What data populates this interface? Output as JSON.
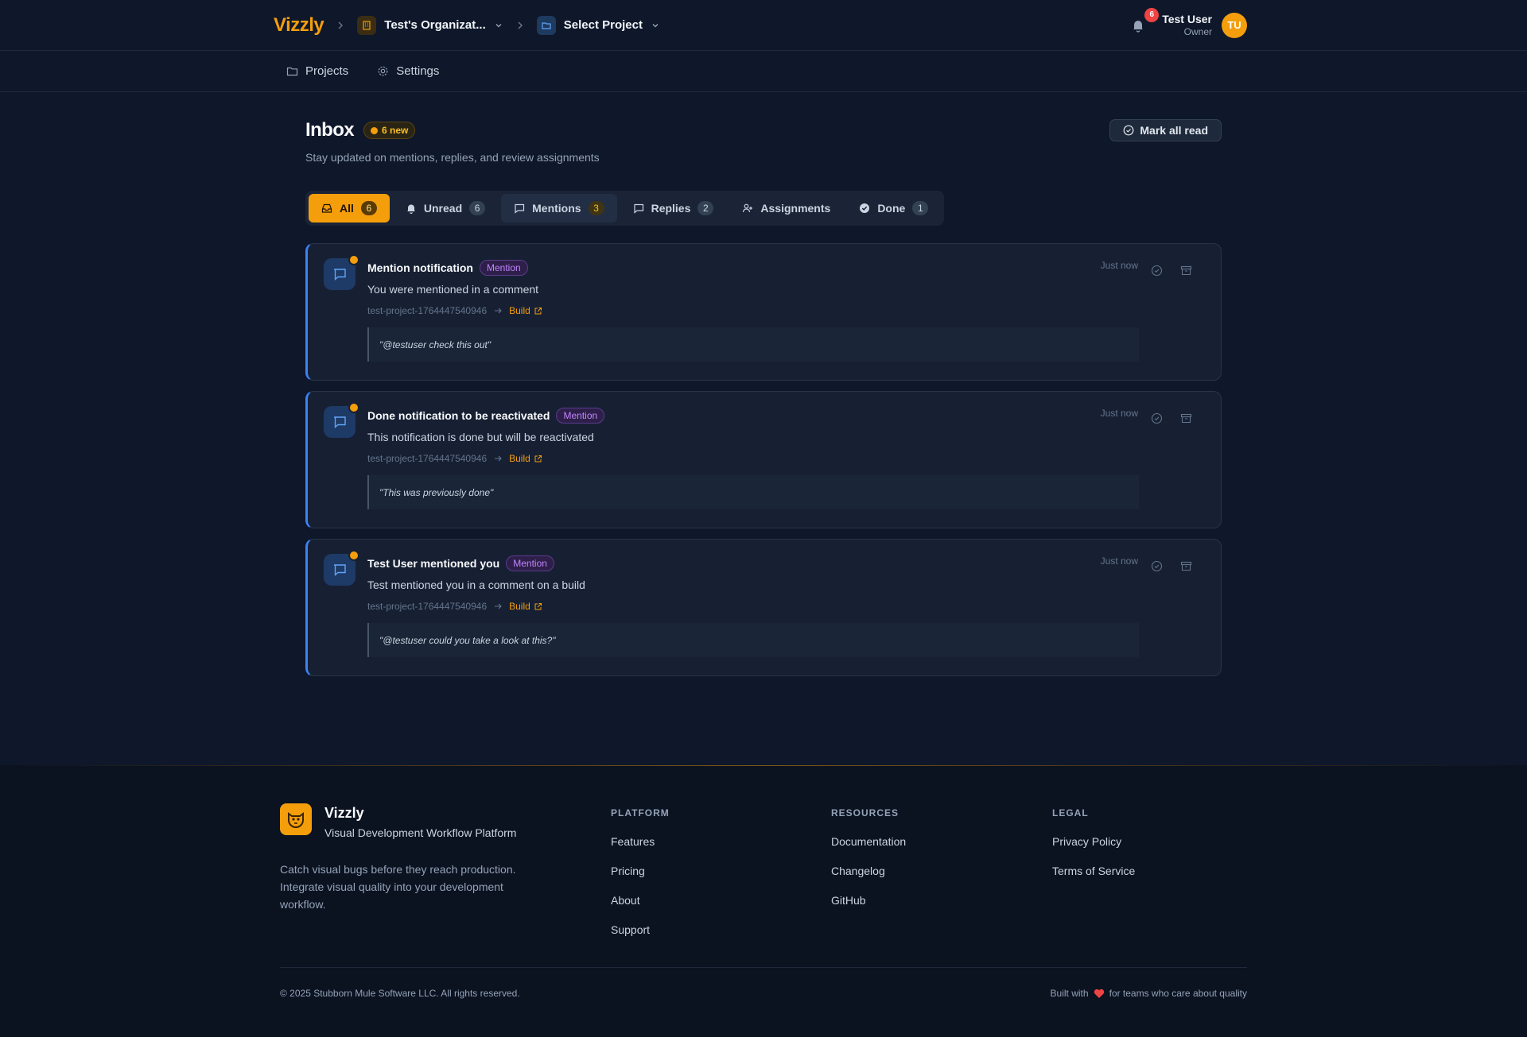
{
  "header": {
    "logo": "Vizzly",
    "org_name": "Test's Organizat...",
    "project_name": "Select Project",
    "notification_count": "6",
    "user_name": "Test User",
    "user_role": "Owner",
    "avatar_initials": "TU"
  },
  "subnav": {
    "items": [
      {
        "label": "Projects",
        "icon": "folder-icon"
      },
      {
        "label": "Settings",
        "icon": "gear-icon"
      }
    ]
  },
  "inbox": {
    "title": "Inbox",
    "new_badge": "6 new",
    "subtitle": "Stay updated on mentions, replies, and review assignments",
    "mark_all_read": "Mark all read",
    "tabs": [
      {
        "label": "All",
        "count": "6",
        "icon": "inbox-icon",
        "active": true
      },
      {
        "label": "Unread",
        "count": "6",
        "icon": "bell-icon"
      },
      {
        "label": "Mentions",
        "count": "3",
        "icon": "comment-icon"
      },
      {
        "label": "Replies",
        "count": "2",
        "icon": "reply-icon"
      },
      {
        "label": "Assignments",
        "count": "",
        "icon": "user-plus-icon"
      },
      {
        "label": "Done",
        "count": "1",
        "icon": "check-circle-icon"
      }
    ],
    "notifications": [
      {
        "title": "Mention notification",
        "type": "Mention",
        "text": "You were mentioned in a comment",
        "project": "test-project-1764447540946",
        "link": "Build",
        "quote": "\"@testuser check this out\"",
        "time": "Just now"
      },
      {
        "title": "Done notification to be reactivated",
        "type": "Mention",
        "text": "This notification is done but will be reactivated",
        "project": "test-project-1764447540946",
        "link": "Build",
        "quote": "\"This was previously done\"",
        "time": "Just now"
      },
      {
        "title": "Test User mentioned you",
        "type": "Mention",
        "text": "Test mentioned you in a comment on a build",
        "project": "test-project-1764447540946",
        "link": "Build",
        "quote": "\"@testuser could you take a look at this?\"",
        "time": "Just now"
      }
    ]
  },
  "footer": {
    "brand": "Vizzly",
    "tagline": "Visual Development Workflow Platform",
    "description": "Catch visual bugs before they reach production. Integrate visual quality into your development workflow.",
    "columns": [
      {
        "heading": "PLATFORM",
        "links": [
          "Features",
          "Pricing",
          "About",
          "Support"
        ]
      },
      {
        "heading": "RESOURCES",
        "links": [
          "Documentation",
          "Changelog",
          "GitHub"
        ]
      },
      {
        "heading": "LEGAL",
        "links": [
          "Privacy Policy",
          "Terms of Service"
        ]
      }
    ],
    "copyright": "© 2025 Stubborn Mule Software LLC. All rights reserved.",
    "built_with_prefix": "Built with",
    "built_with_suffix": "for teams who care about quality"
  },
  "colors": {
    "background": "#0f172a",
    "accent": "#f59e0b",
    "unread_border": "#3b82f6",
    "mention_badge": "#c084fc"
  }
}
